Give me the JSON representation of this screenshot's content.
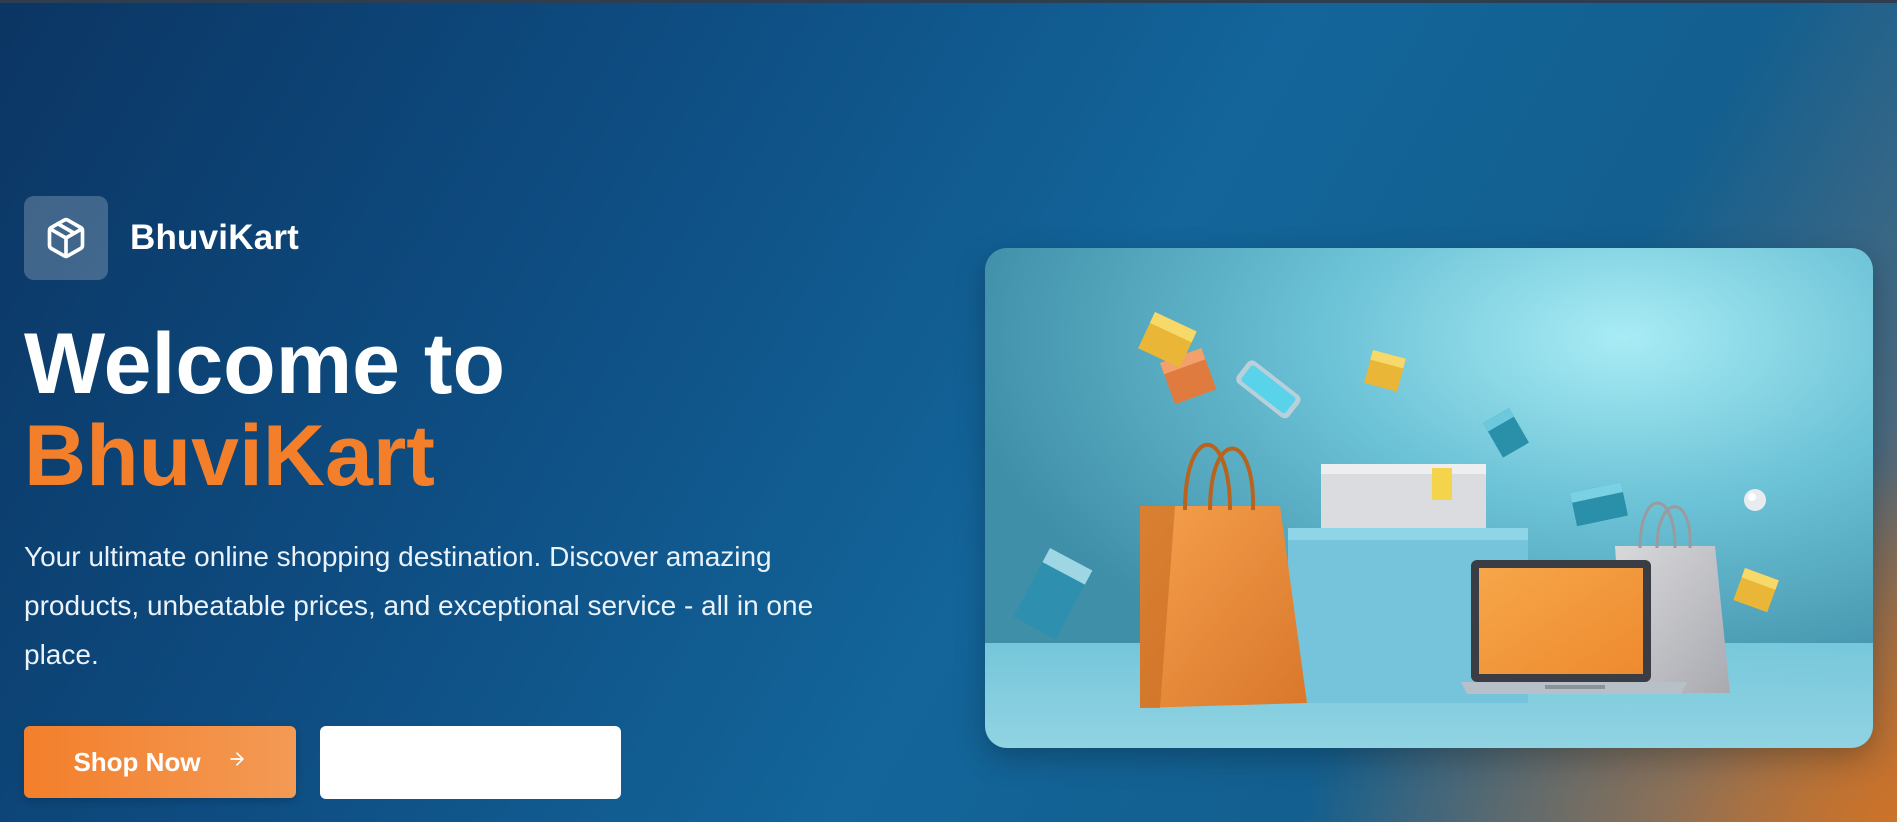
{
  "brand": {
    "name": "BhuviKart",
    "logo_icon": "package-box-icon"
  },
  "hero": {
    "title_line1": "Welcome to",
    "title_accent": "BhuviKart",
    "subtitle": "Your ultimate online shopping destination. Discover amazing products, unbeatable prices, and exceptional service - all in one place.",
    "primary_button": {
      "label": "Shop Now",
      "icon": "arrow-right-icon"
    },
    "secondary_button": {
      "label": ""
    }
  },
  "colors": {
    "accent": "#f37f2b",
    "primary_bg": "#0e4d82",
    "highlight_bg": "#a8ecf5"
  }
}
